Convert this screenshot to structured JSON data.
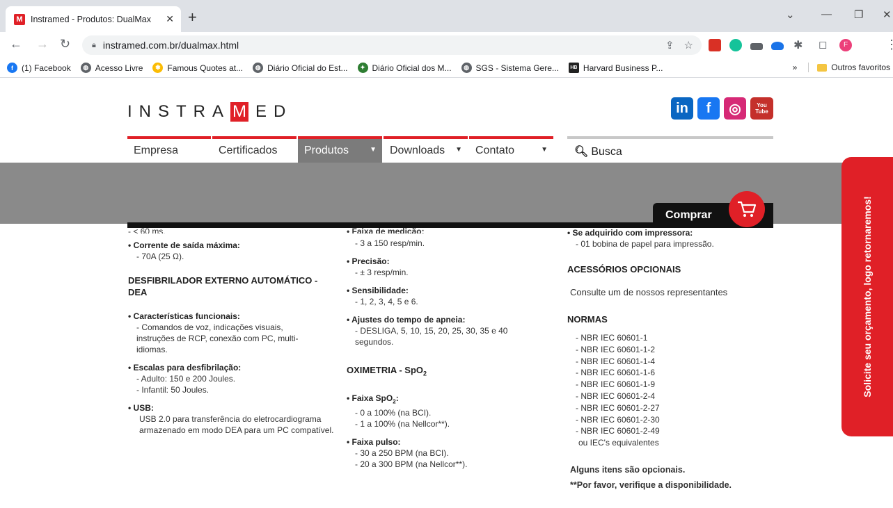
{
  "browser": {
    "tab_title": "Instramed - Produtos: DualMax",
    "tab_favicon": "M",
    "url": "instramed.com.br/dualmax.html",
    "bookmarks": [
      {
        "label": "(1) Facebook",
        "icon": "facebook-icon"
      },
      {
        "label": "Acesso Livre",
        "icon": "globe-icon"
      },
      {
        "label": "Famous Quotes at...",
        "icon": "pinwheel-icon"
      },
      {
        "label": "Diário Oficial do Est...",
        "icon": "globe-icon"
      },
      {
        "label": "Diário Oficial dos M...",
        "icon": "bird-icon"
      },
      {
        "label": "SGS - Sistema Gere...",
        "icon": "globe-icon"
      },
      {
        "label": "Harvard Business P...",
        "icon": "hb-icon"
      }
    ],
    "bookmarks_more": "»",
    "other_bookmarks": "Outros favoritos",
    "profile_initial": "F"
  },
  "site": {
    "logo_left": "INSTRA",
    "logo_m": "M",
    "logo_right": "ED",
    "social": [
      "in",
      "f",
      "◎",
      "You Tube"
    ],
    "menu": [
      {
        "label": "Empresa"
      },
      {
        "label": "Certificados"
      },
      {
        "label": "Produtos"
      },
      {
        "label": "Downloads"
      },
      {
        "label": "Contato"
      }
    ],
    "search_label": "Busca",
    "comprar": "Comprar",
    "side_tab": "Solicite seu orçamento, logo retornaremos!"
  },
  "content": {
    "col1": {
      "cut_top": "- < 60 ms.",
      "corrente_h": "• Corrente de saída máxima:",
      "corrente_v": "- 70A (25 Ω).",
      "dea_title": "DESFIBRILADOR EXTERNO AUTOMÁTICO - DEA",
      "carac_h": "• Características funcionais:",
      "carac_v": "- Comandos de voz, indicações visuais, instruções de RCP, conexão com PC, multi-idiomas.",
      "escalas_h": "• Escalas para desfibrilação:",
      "escalas_v1": "- Adulto: 150 e 200 Joules.",
      "escalas_v2": "- Infantil: 50 Joules.",
      "usb_h": "• USB:",
      "usb_v": "USB 2.0 para transferência do eletrocardiograma armazenado em modo DEA para um PC compatível."
    },
    "col2": {
      "cut_top": "• Faixa de medição:",
      "faixa_v": "- 3 a 150 resp/min.",
      "precisao_h": "• Precisão:",
      "precisao_v": "- ± 3 resp/min.",
      "sens_h": "• Sensibilidade:",
      "sens_v": "- 1, 2, 3, 4, 5 e 6.",
      "apneia_h": "• Ajustes do tempo de apneia:",
      "apneia_v": "- DESLIGA, 5, 10, 15, 20, 25, 30, 35 e 40 segundos.",
      "oxi_title": "OXIMETRIA - SpO",
      "oxi_sub": "2",
      "spo2_h": "• Faixa SpO",
      "spo2_sub": "2",
      "spo2_colon": ":",
      "spo2_v1": "- 0 a 100% (na BCI).",
      "spo2_v2": "- 1 a 100% (na Nellcor**).",
      "pulso_h": "• Faixa pulso:",
      "pulso_v1": "- 30 a 250 BPM (na BCI).",
      "pulso_v2": "- 20 a 300 BPM (na Nellcor**)."
    },
    "col3": {
      "impressora_h": "• Se adquirido com impressora:",
      "impressora_v": "- 01 bobina de papel para impressão.",
      "acess_title": "ACESSÓRIOS OPCIONAIS",
      "acess_v": "Consulte um de nossos representantes",
      "normas_title": "NORMAS",
      "normas": [
        "- NBR IEC 60601-1",
        "- NBR IEC 60601-1-2",
        "- NBR IEC 60601-1-4",
        "- NBR IEC 60601-1-6",
        "- NBR IEC 60601-1-9",
        "- NBR IEC 60601-2-4",
        "- NBR IEC 60601-2-27",
        "- NBR IEC 60601-2-30",
        "- NBR IEC 60601-2-49"
      ],
      "normas_equiv": "ou IEC's equivalentes",
      "opcionais": "Alguns itens são opcionais.",
      "verifique": "**Por favor, verifique a disponibilidade."
    }
  },
  "colors": {
    "brand_red": "#e02027",
    "menu_active": "#7b7b7b",
    "band_gray": "#8a8a8a"
  }
}
